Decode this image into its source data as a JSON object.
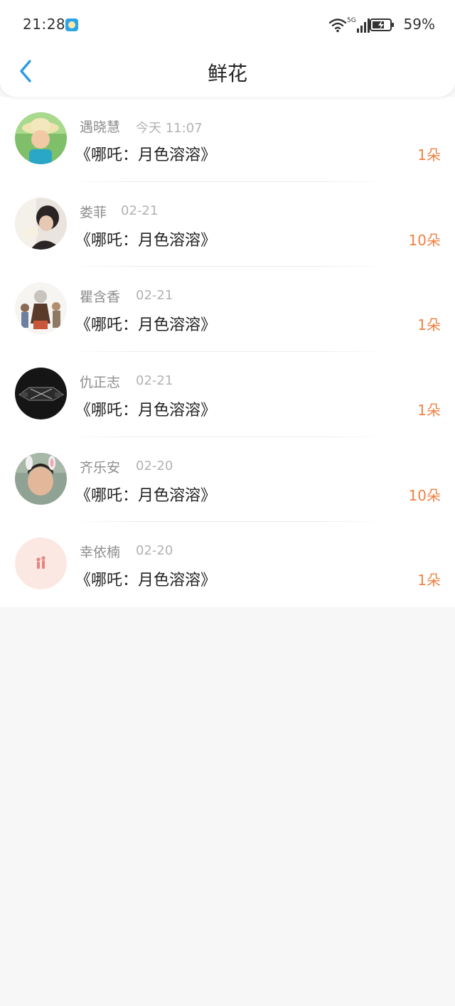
{
  "status_bar": {
    "time": "21:28",
    "network": "5G",
    "battery": "59%"
  },
  "nav": {
    "title": "鲜花",
    "back_icon": "chevron-left-icon"
  },
  "colors": {
    "accent_blue": "#2a9be2",
    "count_orange": "#f08143",
    "name_gray": "#8d8d8d",
    "date_gray": "#b2b2b2"
  },
  "gifts": [
    {
      "name": "遇晓慧",
      "date": "今天 11:07",
      "work": "《哪吒：月色溶溶》",
      "count": "1朵"
    },
    {
      "name": "娄菲",
      "date": "02-21",
      "work": "《哪吒：月色溶溶》",
      "count": "10朵"
    },
    {
      "name": "瞿含香",
      "date": "02-21",
      "work": "《哪吒：月色溶溶》",
      "count": "1朵"
    },
    {
      "name": "仇正志",
      "date": "02-21",
      "work": "《哪吒：月色溶溶》",
      "count": "1朵"
    },
    {
      "name": "齐乐安",
      "date": "02-20",
      "work": "《哪吒：月色溶溶》",
      "count": "10朵"
    },
    {
      "name": "幸依楠",
      "date": "02-20",
      "work": "《哪吒：月色溶溶》",
      "count": "1朵"
    }
  ]
}
